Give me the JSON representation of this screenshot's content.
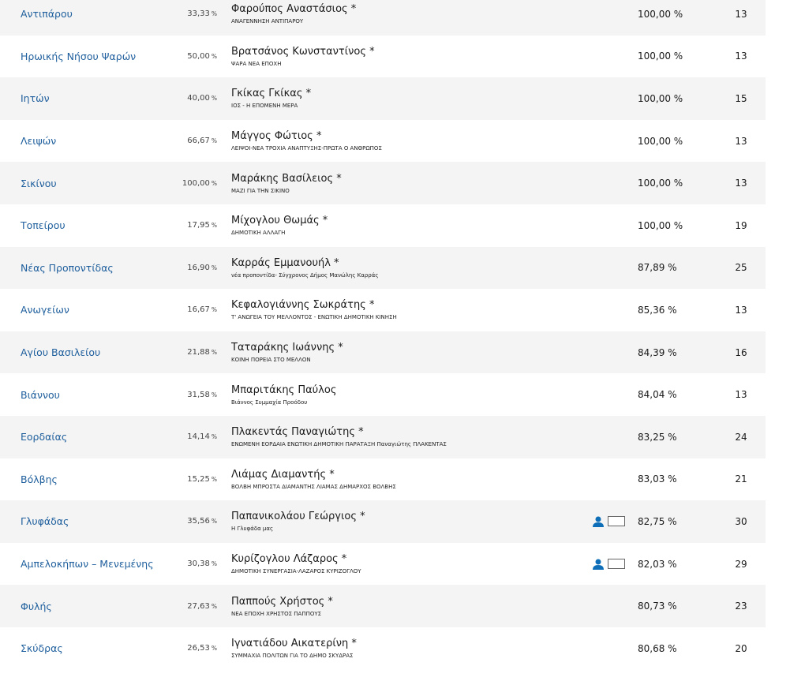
{
  "rows": [
    {
      "municipality": "Αντιπάρου",
      "turnout": "33,33",
      "turnout_unit": "%",
      "candidate": "Φαρούπος Αναστάσιος *",
      "party": "ΑΝΑΓΕΝΝΗΣΗ ΑΝΤΙΠΑΡΟΥ",
      "result": "100,00 %",
      "seats": "13",
      "icons": false
    },
    {
      "municipality": "Ηρωικής Νήσου Ψαρών",
      "turnout": "50,00",
      "turnout_unit": "%",
      "candidate": "Βρατσάνος Κωνσταντίνος *",
      "party": "ΨΑΡΑ ΝΕΑ ΕΠΟΧΗ",
      "result": "100,00 %",
      "seats": "13",
      "icons": false
    },
    {
      "municipality": "Ιητών",
      "turnout": "40,00",
      "turnout_unit": "%",
      "candidate": "Γκίκας Γκίκας *",
      "party": "ΙΟΣ - Η ΕΠΟΜΕΝΗ ΜΕΡΑ",
      "result": "100,00 %",
      "seats": "15",
      "icons": false
    },
    {
      "municipality": "Λειψών",
      "turnout": "66,67",
      "turnout_unit": "%",
      "candidate": "Μάγγος Φώτιος *",
      "party": "ΛΕΙΨΟΙ-ΝΕΑ ΤΡΟΧΙΑ ΑΝΑΠΤΥΞΗΣ-ΠΡΩΤΑ Ο ΑΝΘΡΩΠΟΣ",
      "result": "100,00 %",
      "seats": "13",
      "icons": false
    },
    {
      "municipality": "Σικίνου",
      "turnout": "100,00",
      "turnout_unit": "%",
      "candidate": "Μαράκης Βασίλειος *",
      "party": "ΜΑΖΙ ΓΙΑ ΤΗΝ ΣΙΚΙΝΟ",
      "result": "100,00 %",
      "seats": "13",
      "icons": false
    },
    {
      "municipality": "Τοπείρου",
      "turnout": "17,95",
      "turnout_unit": "%",
      "candidate": "Μίχογλου Θωμάς *",
      "party": "ΔΗΜΟΤΙΚΗ ΑΛΛΑΓΗ",
      "result": "100,00 %",
      "seats": "19",
      "icons": false
    },
    {
      "municipality": "Νέας Προποντίδας",
      "turnout": "16,90",
      "turnout_unit": "%",
      "candidate": "Καρράς Εμμανουήλ *",
      "party": "νέα προποντίδα- Σύγχρονος Δήμος Μανώλης Καρράς",
      "result": "87,89 %",
      "seats": "25",
      "icons": false
    },
    {
      "municipality": "Ανωγείων",
      "turnout": "16,67",
      "turnout_unit": "%",
      "candidate": "Κεφαλογιάννης Σωκράτης *",
      "party": "Τ' ΑΝΩΓΕΙΑ ΤΟΥ ΜΕΛΛΟΝΤΟΣ - ΕΝΩΤΙΚΗ ΔΗΜΟΤΙΚΗ ΚΙΝΗΣΗ",
      "result": "85,36 %",
      "seats": "13",
      "icons": false
    },
    {
      "municipality": "Αγίου Βασιλείου",
      "turnout": "21,88",
      "turnout_unit": "%",
      "candidate": "Ταταράκης Ιωάννης *",
      "party": "ΚΟΙΝΗ ΠΟΡΕΙΑ ΣΤΟ ΜΕΛΛΟΝ",
      "result": "84,39 %",
      "seats": "16",
      "icons": false
    },
    {
      "municipality": "Βιάννου",
      "turnout": "31,58",
      "turnout_unit": "%",
      "candidate": "Μπαριτάκης Παύλος",
      "party": "Βιάννος Συμμαχία Προόδου",
      "result": "84,04 %",
      "seats": "13",
      "icons": false
    },
    {
      "municipality": "Εορδαίας",
      "turnout": "14,14",
      "turnout_unit": "%",
      "candidate": "Πλακεντάς Παναγιώτης *",
      "party": "ΕΝΩΜΕΝΗ ΕΟΡΔΑΙΑ ΕΝΩΤΙΚΗ ΔΗΜΟΤΙΚΗ ΠΑΡΑΤΑΞΗ Παναγιώτης ΠΛΑΚΕΝΤΑΣ",
      "result": "83,25 %",
      "seats": "24",
      "icons": false
    },
    {
      "municipality": "Βόλβης",
      "turnout": "15,25",
      "turnout_unit": "%",
      "candidate": "Λιάμας Διαμαντής *",
      "party": "ΒΟΛΒΗ ΜΠΡΟΣΤΑ ΔΙΑΜΑΝΤΗΣ ΛΙΑΜΑΣ ΔΗΜΑΡΧΟΣ ΒΟΛΒΗΣ",
      "result": "83,03 %",
      "seats": "21",
      "icons": false
    },
    {
      "municipality": "Γλυφάδας",
      "turnout": "35,56",
      "turnout_unit": "%",
      "candidate": "Παπανικολάου Γεώργιος *",
      "party": "Η Γλυφάδα μας",
      "result": "82,75 %",
      "seats": "30",
      "icons": true
    },
    {
      "municipality": "Αμπελοκήπων – Μενεμένης",
      "turnout": "30,38",
      "turnout_unit": "%",
      "candidate": "Κυρίζογλου Λάζαρος *",
      "party": "ΔΗΜΟΤΙΚΗ ΣΥΝΕΡΓΑΣΙΑ-ΛΑΖΑΡΟΣ ΚΥΡΙΖΟΓΛΟΥ",
      "result": "82,03 %",
      "seats": "29",
      "icons": true
    },
    {
      "municipality": "Φυλής",
      "turnout": "27,63",
      "turnout_unit": "%",
      "candidate": "Παππούς Χρήστος *",
      "party": "ΝΕΑ ΕΠΟΧΗ ΧΡΗΣΤΟΣ ΠΑΠΠΟΥΣ",
      "result": "80,73 %",
      "seats": "23",
      "icons": false
    },
    {
      "municipality": "Σκύδρας",
      "turnout": "26,53",
      "turnout_unit": "%",
      "candidate": "Ιγνατιάδου Αικατερίνη *",
      "party": "ΣΥΜΜΑΧΙΑ ΠΟΛΙΤΩΝ ΓΙΑ ΤΟ ΔΗΜΟ ΣΚΥΔΡΑΣ",
      "result": "80,68 %",
      "seats": "20",
      "icons": false
    }
  ],
  "colors": {
    "link": "#1f5f9d",
    "icon_blue": "#0e6fb8",
    "row_alt": "#f4f4f4"
  }
}
